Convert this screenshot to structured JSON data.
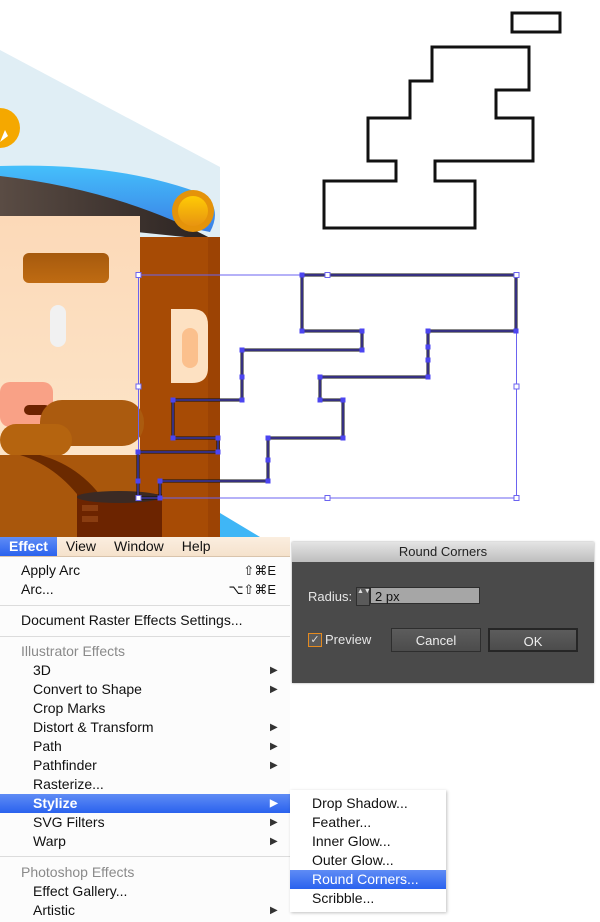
{
  "menubar": {
    "items": [
      {
        "label": "Effect",
        "active": true
      },
      {
        "label": "View"
      },
      {
        "label": "Window"
      },
      {
        "label": "Help"
      }
    ]
  },
  "effect_menu": {
    "apply_arc": {
      "label": "Apply Arc",
      "shortcut": "⇧⌘E"
    },
    "arc": {
      "label": "Arc...",
      "shortcut": "⌥⇧⌘E"
    },
    "raster_settings": {
      "label": "Document Raster Effects Settings..."
    },
    "illustrator_header": "Illustrator Effects",
    "illustrator_items": [
      {
        "label": "3D",
        "submenu": true
      },
      {
        "label": "Convert to Shape",
        "submenu": true
      },
      {
        "label": "Crop Marks",
        "submenu": false
      },
      {
        "label": "Distort & Transform",
        "submenu": true
      },
      {
        "label": "Path",
        "submenu": true
      },
      {
        "label": "Pathfinder",
        "submenu": true
      },
      {
        "label": "Rasterize...",
        "submenu": false
      },
      {
        "label": "Stylize",
        "submenu": true,
        "highlighted": true
      },
      {
        "label": "SVG Filters",
        "submenu": true
      },
      {
        "label": "Warp",
        "submenu": true
      }
    ],
    "photoshop_header": "Photoshop Effects",
    "photoshop_items": [
      {
        "label": "Effect Gallery...",
        "submenu": false
      },
      {
        "label": "Artistic",
        "submenu": true
      }
    ],
    "arrow_glyph": "▶"
  },
  "stylize_submenu": {
    "items": [
      {
        "label": "Drop Shadow..."
      },
      {
        "label": "Feather..."
      },
      {
        "label": "Inner Glow..."
      },
      {
        "label": "Outer Glow..."
      },
      {
        "label": "Round Corners...",
        "highlighted": true
      },
      {
        "label": "Scribble..."
      }
    ]
  },
  "dialog": {
    "title": "Round Corners",
    "radius_label": "Radius:",
    "radius_value": "2 px",
    "stepper_glyph": "▲▼",
    "preview_label": "Preview",
    "preview_checked": true,
    "check_glyph": "✓",
    "cancel_label": "Cancel",
    "ok_label": "OK"
  },
  "colors": {
    "menu_highlight": "#2a62ee",
    "selection_stroke": "#5a50f0",
    "path_stroke": "#111111",
    "checkbox_border": "#e58a1e"
  }
}
